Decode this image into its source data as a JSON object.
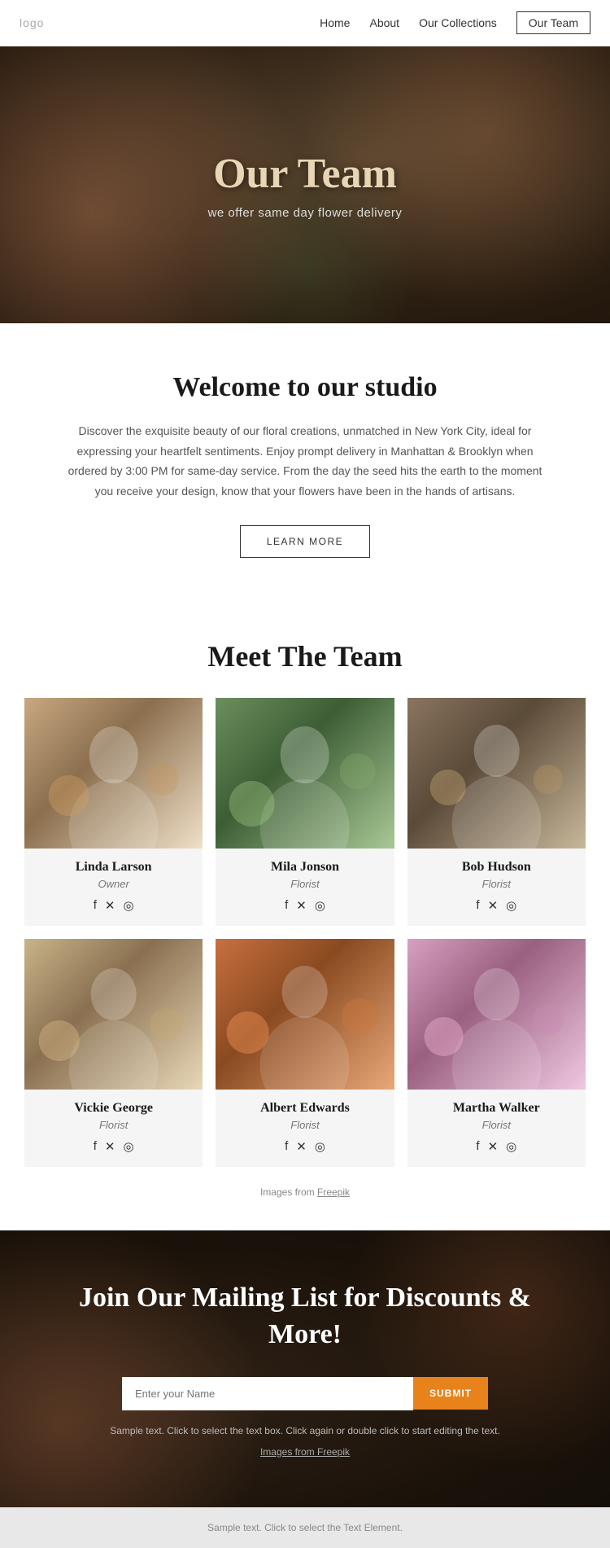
{
  "nav": {
    "logo": "logo",
    "links": [
      {
        "label": "Home",
        "active": false
      },
      {
        "label": "About",
        "active": false
      },
      {
        "label": "Our Collections",
        "active": false
      },
      {
        "label": "Our Team",
        "active": true
      }
    ]
  },
  "hero": {
    "title": "Our Team",
    "subtitle": "we offer same day flower delivery"
  },
  "welcome": {
    "title": "Welcome to our studio",
    "body": "Discover the exquisite beauty of our floral creations, unmatched in New York City, ideal for expressing your heartfelt sentiments. Enjoy prompt delivery in Manhattan & Brooklyn when ordered by 3:00 PM for same-day service.  From the day the seed hits the earth to the moment you receive your design, know that your flowers have been in the hands of artisans.",
    "button": "LEARN MORE"
  },
  "team": {
    "title": "Meet The Team",
    "members": [
      {
        "name": "Linda Larson",
        "role": "Owner",
        "photo_color1": "#c9a882",
        "photo_color2": "#8b6f4e"
      },
      {
        "name": "Mila Jonson",
        "role": "Florist",
        "photo_color1": "#6b8f5e",
        "photo_color2": "#3d5e35"
      },
      {
        "name": "Bob Hudson",
        "role": "Florist",
        "photo_color1": "#8a7560",
        "photo_color2": "#5a4a38"
      },
      {
        "name": "Vickie George",
        "role": "Florist",
        "photo_color1": "#c8b48a",
        "photo_color2": "#8a7050"
      },
      {
        "name": "Albert Edwards",
        "role": "Florist",
        "photo_color1": "#c87040",
        "photo_color2": "#8a4a20"
      },
      {
        "name": "Martha Walker",
        "role": "Florist",
        "photo_color1": "#d8a0c0",
        "photo_color2": "#9a6080"
      }
    ],
    "social_icons": [
      "f",
      "𝕏",
      "📷"
    ],
    "images_credit_prefix": "Images from ",
    "images_credit_link": "Freepik"
  },
  "mailing": {
    "title": "Join Our Mailing List for Discounts & More!",
    "input_placeholder": "Enter your Name",
    "button_label": "SUBMIT",
    "sample_text": "Sample text. Click to select the text box. Click again or double click to start editing the text.",
    "images_credit_prefix": "Images from ",
    "images_credit_link": "Freepik"
  },
  "footer": {
    "text": "Sample text. Click to select the Text Element."
  }
}
